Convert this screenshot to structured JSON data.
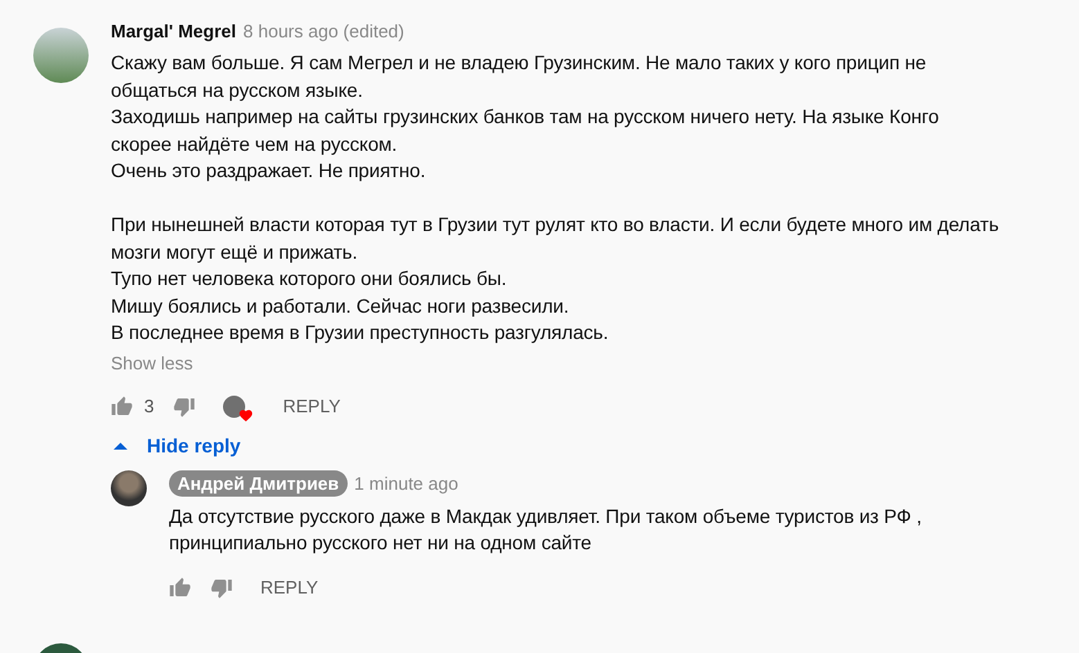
{
  "comment": {
    "author": "Margal' Megrel",
    "time": "8 hours ago (edited)",
    "text": "Скажу вам больше. Я сам Мегрел и не владею Грузинским. Не мало таких у кого прицип не\nобщаться на русском языке.\nЗаходишь например на сайты грузинских банков там на русском ничего нету. На языке Конго\nскорее найдёте чем на русском.\nОчень это раздражает. Не приятно.\n\nПри нынешней власти которая тут в Грузии тут рулят кто во власти. И если будете много им делать\nмозги могут ещё и прижать.\nТупо нет человека которого они боялись бы.\nМишу боялись и работали. Сейчас ноги развесили.\nВ последнее время в Грузии преступность разгулялась.",
    "show_toggle": "Show less",
    "likes": "3",
    "hearted": true,
    "reply_label": "REPLY",
    "replies_expanded": true,
    "replies_toggle": "Hide reply"
  },
  "reply": {
    "author": "Андрей Дмитриев",
    "author_is_owner": true,
    "time": "1 minute ago",
    "text": "Да отсутствие русского даже в Макдак удивляет. При таком объеме туристов из РФ ,\nпринципиально русского нет ни на одном сайте",
    "reply_label": "REPLY"
  }
}
